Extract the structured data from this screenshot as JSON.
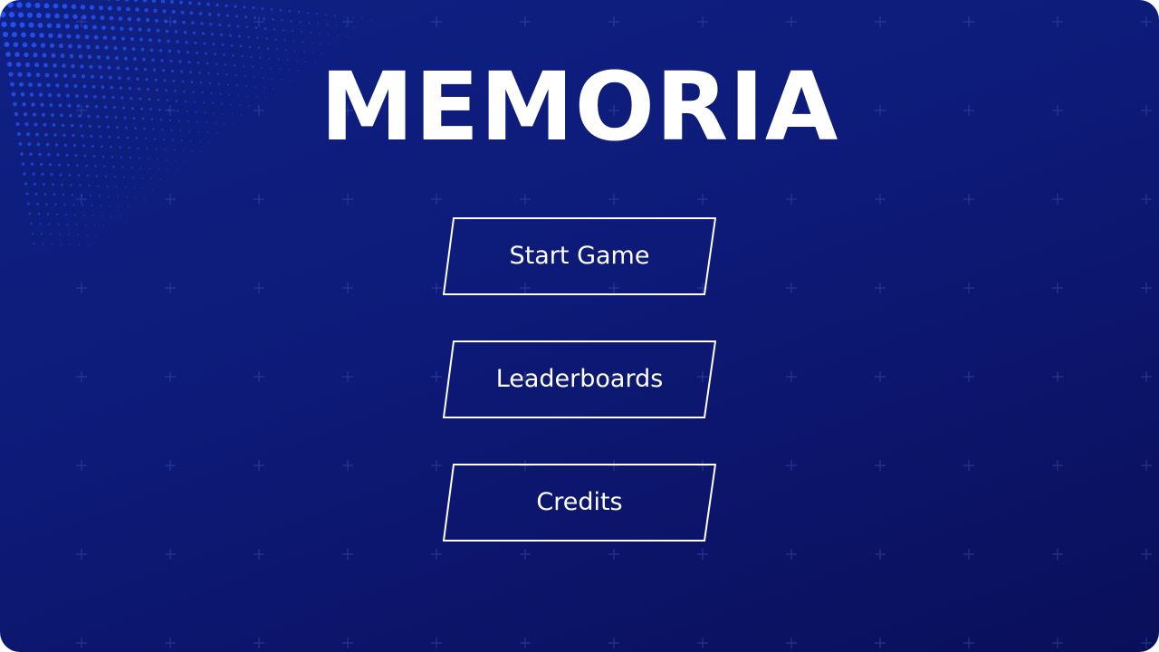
{
  "game": {
    "title": "MEMORIA"
  },
  "menu": {
    "start_label": "Start Game",
    "leaderboards_label": "Leaderboards",
    "credits_label": "Credits"
  },
  "colors": {
    "background_top": "#0f2184",
    "background_bottom": "#0a0f5a",
    "dot_accent": "#2a55ff",
    "text": "#ffffff",
    "button_border": "#ffffff"
  }
}
